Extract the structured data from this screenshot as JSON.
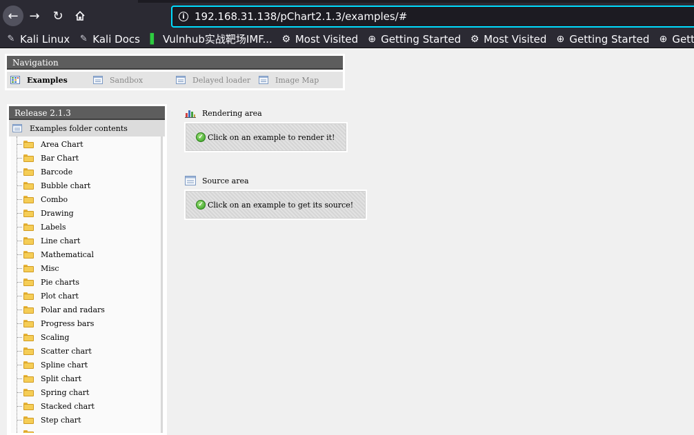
{
  "browser": {
    "url": "192.168.31.138/pChart2.1.3/examples/#",
    "bookmarks": [
      {
        "label": "Kali Linux",
        "icon": "kali-dragon-icon"
      },
      {
        "label": "Kali Docs",
        "icon": "kali-dragon-icon"
      },
      {
        "label": "Vulnhub实战靶场IMF...",
        "icon": "vulnhub-icon"
      },
      {
        "label": "Most Visited",
        "icon": "gear-icon"
      },
      {
        "label": "Getting Started",
        "icon": "globe-icon"
      },
      {
        "label": "Most Visited",
        "icon": "gear-icon"
      },
      {
        "label": "Getting Started",
        "icon": "globe-icon"
      },
      {
        "label": "Getting Started",
        "icon": "globe-icon"
      }
    ]
  },
  "navigation": {
    "title": "Navigation",
    "tabs": [
      {
        "label": "Examples",
        "active": true
      },
      {
        "label": "Sandbox",
        "active": false
      },
      {
        "label": "Delayed loader",
        "active": false
      },
      {
        "label": "Image Map",
        "active": false
      }
    ]
  },
  "sidebar": {
    "title": "Release 2.1.3",
    "header": "Examples folder contents",
    "folders": [
      "Area Chart",
      "Bar Chart",
      "Barcode",
      "Bubble chart",
      "Combo",
      "Drawing",
      "Labels",
      "Line chart",
      "Mathematical",
      "Misc",
      "Pie charts",
      "Plot chart",
      "Polar and radars",
      "Progress bars",
      "Scaling",
      "Scatter chart",
      "Spline chart",
      "Split chart",
      "Spring chart",
      "Stacked chart",
      "Step chart"
    ]
  },
  "rendering": {
    "label": "Rendering area",
    "message": "Click on an example to render it!"
  },
  "source": {
    "label": "Source area",
    "message": "Click on an example to get its source!"
  },
  "colors": {
    "accent_focus": "#00ddff",
    "header_bg": "#5d5d5d",
    "folder": "#f5cd56",
    "check": "#2f9e1e"
  }
}
